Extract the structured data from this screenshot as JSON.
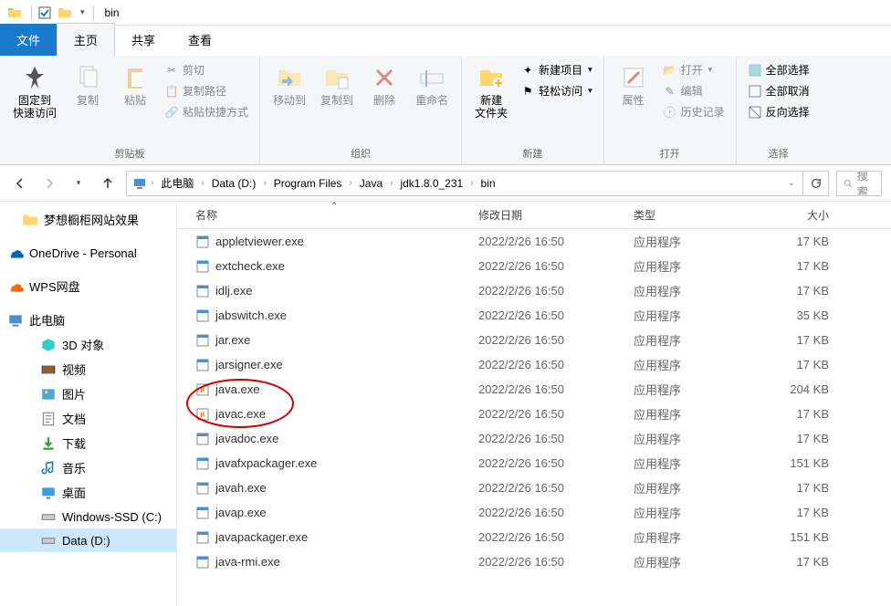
{
  "window": {
    "title": "bin"
  },
  "tabs": {
    "file": "文件",
    "home": "主页",
    "share": "共享",
    "view": "查看"
  },
  "ribbon": {
    "clipboard": {
      "label": "剪贴板",
      "pin": "固定到\n快速访问",
      "copy": "复制",
      "paste": "粘贴",
      "cut": "剪切",
      "copypath": "复制路径",
      "pasteshortcut": "粘贴快捷方式"
    },
    "organize": {
      "label": "组织",
      "moveto": "移动到",
      "copyto": "复制到",
      "delete": "删除",
      "rename": "重命名"
    },
    "new": {
      "label": "新建",
      "newfolder": "新建\n文件夹",
      "newitem": "新建项目",
      "easyaccess": "轻松访问"
    },
    "open": {
      "label": "打开",
      "properties": "属性",
      "open": "打开",
      "edit": "编辑",
      "history": "历史记录"
    },
    "select": {
      "label": "选择",
      "selectall": "全部选择",
      "selectnone": "全部取消",
      "invert": "反向选择"
    }
  },
  "breadcrumb": {
    "segs": [
      "此电脑",
      "Data (D:)",
      "Program Files",
      "Java",
      "jdk1.8.0_231",
      "bin"
    ]
  },
  "search": {
    "placeholder": "搜索"
  },
  "tree": {
    "dream": "梦想橱柜网站效果",
    "onedrive": "OneDrive - Personal",
    "wps": "WPS网盘",
    "thispc": "此电脑",
    "objects3d": "3D 对象",
    "videos": "视频",
    "pictures": "图片",
    "documents": "文档",
    "downloads": "下载",
    "music": "音乐",
    "desktop": "桌面",
    "winssd": "Windows-SSD (C:)",
    "datad": "Data (D:)"
  },
  "columns": {
    "name": "名称",
    "date": "修改日期",
    "type": "类型",
    "size": "大小"
  },
  "files": [
    {
      "name": "appletviewer.exe",
      "date": "2022/2/26 16:50",
      "type": "应用程序",
      "size": "17 KB",
      "icon": "exe"
    },
    {
      "name": "extcheck.exe",
      "date": "2022/2/26 16:50",
      "type": "应用程序",
      "size": "17 KB",
      "icon": "exe"
    },
    {
      "name": "idlj.exe",
      "date": "2022/2/26 16:50",
      "type": "应用程序",
      "size": "17 KB",
      "icon": "exe"
    },
    {
      "name": "jabswitch.exe",
      "date": "2022/2/26 16:50",
      "type": "应用程序",
      "size": "35 KB",
      "icon": "exe"
    },
    {
      "name": "jar.exe",
      "date": "2022/2/26 16:50",
      "type": "应用程序",
      "size": "17 KB",
      "icon": "exe"
    },
    {
      "name": "jarsigner.exe",
      "date": "2022/2/26 16:50",
      "type": "应用程序",
      "size": "17 KB",
      "icon": "exe"
    },
    {
      "name": "java.exe",
      "date": "2022/2/26 16:50",
      "type": "应用程序",
      "size": "204 KB",
      "icon": "java"
    },
    {
      "name": "javac.exe",
      "date": "2022/2/26 16:50",
      "type": "应用程序",
      "size": "17 KB",
      "icon": "java"
    },
    {
      "name": "javadoc.exe",
      "date": "2022/2/26 16:50",
      "type": "应用程序",
      "size": "17 KB",
      "icon": "exe"
    },
    {
      "name": "javafxpackager.exe",
      "date": "2022/2/26 16:50",
      "type": "应用程序",
      "size": "151 KB",
      "icon": "exe"
    },
    {
      "name": "javah.exe",
      "date": "2022/2/26 16:50",
      "type": "应用程序",
      "size": "17 KB",
      "icon": "exe"
    },
    {
      "name": "javap.exe",
      "date": "2022/2/26 16:50",
      "type": "应用程序",
      "size": "17 KB",
      "icon": "exe"
    },
    {
      "name": "javapackager.exe",
      "date": "2022/2/26 16:50",
      "type": "应用程序",
      "size": "151 KB",
      "icon": "exe"
    },
    {
      "name": "java-rmi.exe",
      "date": "2022/2/26 16:50",
      "type": "应用程序",
      "size": "17 KB",
      "icon": "exe"
    }
  ]
}
